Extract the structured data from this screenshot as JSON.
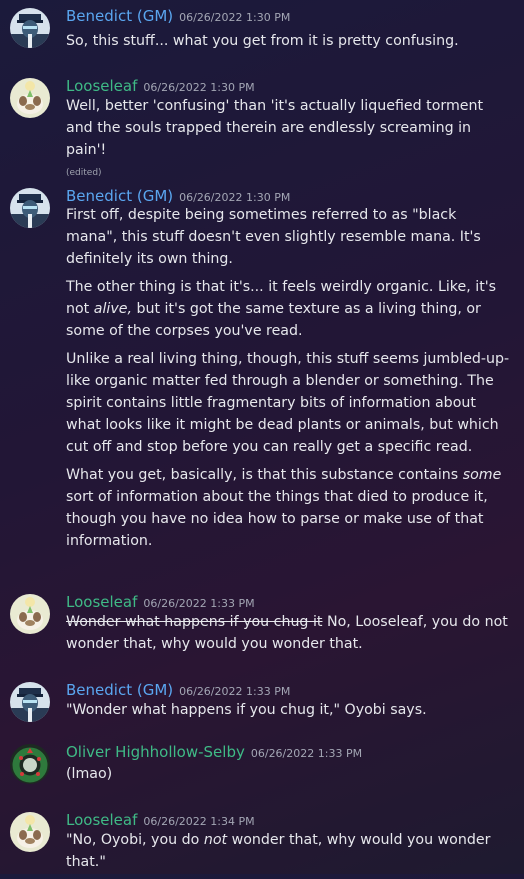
{
  "colors": {
    "gm_name": "#5aa6f0",
    "leaf_name": "#3fba86",
    "oliver_name": "#3fba86"
  },
  "messages": [
    {
      "author": "Benedict (GM)",
      "time": "06/26/2022 1:30 PM",
      "avatar": "benedict-avatar",
      "paragraphs": [
        "So, this stuff... what you get from it is pretty confusing."
      ]
    },
    {
      "author": "Looseleaf",
      "time": "06/26/2022 1:30 PM",
      "avatar": "looseleaf-avatar",
      "paragraphs": [
        "Well, better 'confusing' than 'it's actually liquefied torment and the souls trapped therein are endlessly screaming in pain'!"
      ],
      "edited": "(edited)"
    },
    {
      "author": "Benedict (GM)",
      "time": "06/26/2022 1:30 PM",
      "avatar": "benedict-avatar",
      "p1": "First off, despite being sometimes referred to as \"black mana\", this stuff doesn't even slightly resemble mana. It's definitely its own thing.",
      "p2a": "The other thing is that it's... it feels weirdly organic. Like, it's not ",
      "p2b": "alive,",
      "p2c": " but it's got the same texture as a living thing, or some of the corpses you've read.",
      "p3": "Unlike a real living thing, though, this stuff seems jumbled-up- like organic matter fed through a blender or something. The spirit contains little fragmentary bits of information about what looks like it might be dead plants or animals, but which cut off and stop before you can really get a specific read.",
      "p4a": "What you get, basically, is that this substance contains ",
      "p4b": "some",
      "p4c": " sort of information about the things that died to produce it, though you have no idea how to parse or make use of that information."
    },
    {
      "author": "Looseleaf",
      "time": "06/26/2022 1:33 PM",
      "avatar": "looseleaf-avatar",
      "strike": "Wonder what happens if you chug it",
      "rest": " No, Looseleaf, you do not wonder that, why would you wonder that."
    },
    {
      "author": "Benedict (GM)",
      "time": "06/26/2022 1:33 PM",
      "avatar": "benedict-avatar",
      "paragraphs": [
        "\"Wonder what happens if you chug it,\" Oyobi says."
      ]
    },
    {
      "author": "Oliver Highhollow-Selby",
      "time": "06/26/2022 1:33 PM",
      "avatar": "wreath-avatar",
      "paragraphs": [
        "(lmao)"
      ]
    },
    {
      "author": "Looseleaf",
      "time": "06/26/2022 1:34 PM",
      "avatar": "looseleaf-avatar",
      "p1a": "\"No, Oyobi, you do ",
      "p1b": "not",
      "p1c": " wonder that, why would you wonder that.\""
    }
  ]
}
